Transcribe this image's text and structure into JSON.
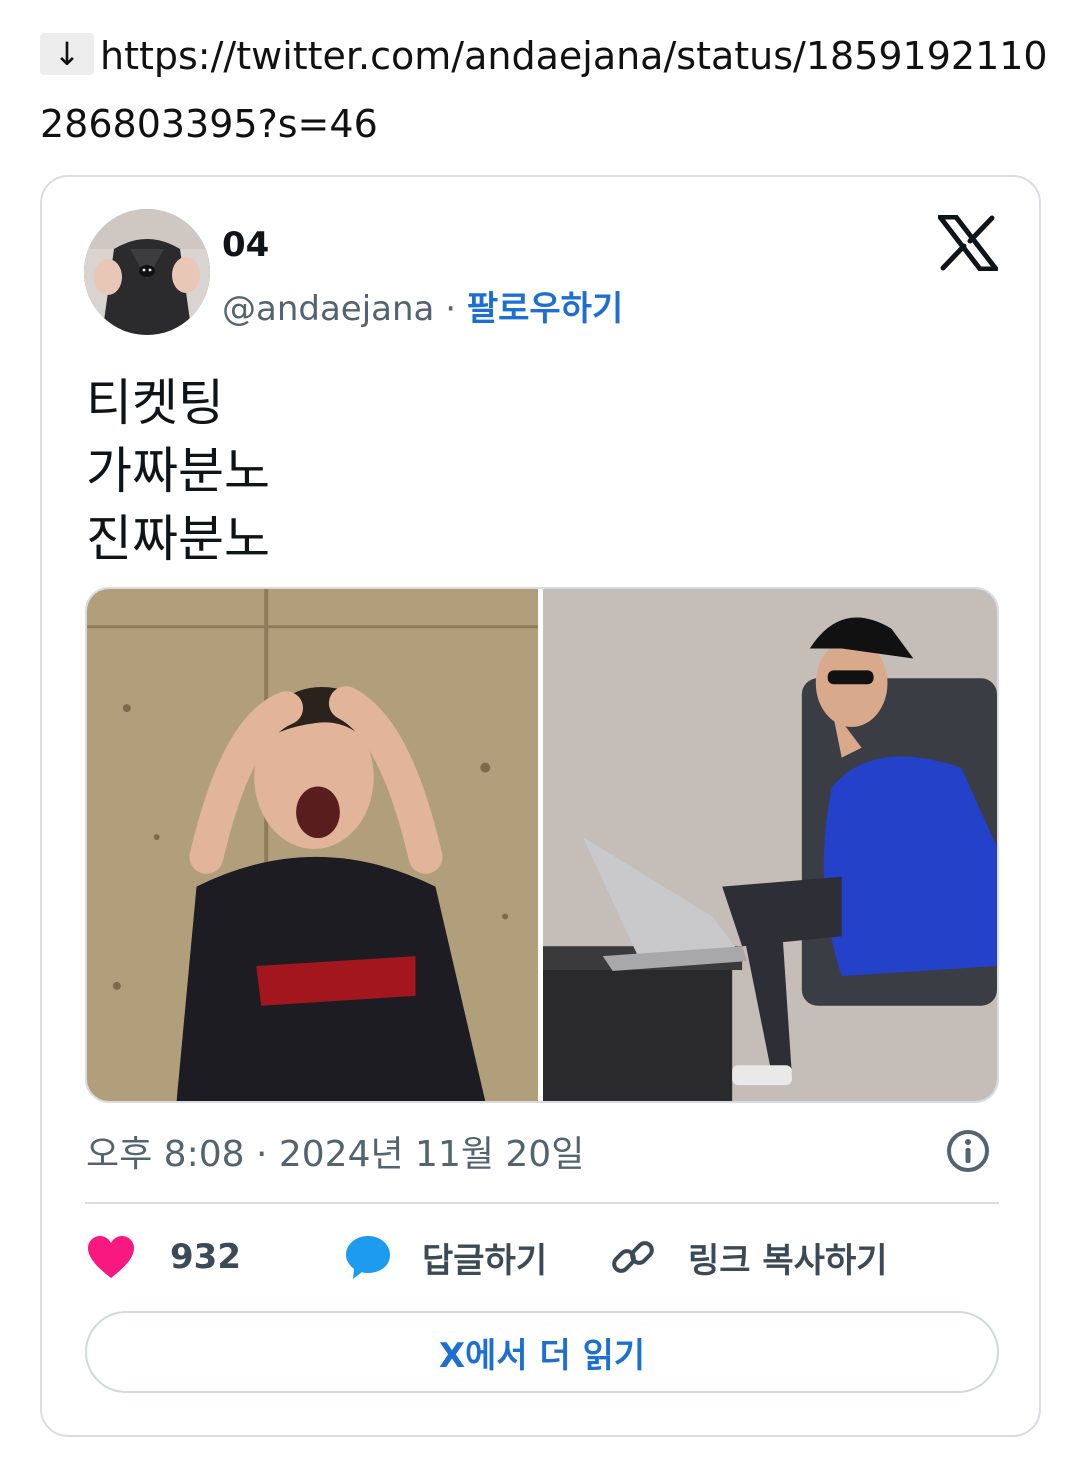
{
  "link": {
    "arrow": "↓",
    "url": "https://twitter.com/andaejana/status/1859192110286803395?s=46"
  },
  "tweet": {
    "display_name": "04",
    "handle": "@andaejana",
    "separator": " · ",
    "follow_label": "팔로우하기",
    "text_lines": [
      "티켓팅",
      "가짜분노",
      "진짜분노"
    ],
    "timestamp": "오후 8:08 · 2024년 11월 20일",
    "likes": "932",
    "reply_label": "답글하기",
    "copy_link_label": "링크 복사하기",
    "read_more_label": "X에서 더 읽기"
  },
  "icons": {
    "brand": "x-logo",
    "like": "heart-icon",
    "reply": "speech-bubble-icon",
    "copy": "link-icon",
    "info": "info-icon"
  },
  "colors": {
    "link_blue": "#1d6fd1",
    "heart": "#f91880",
    "reply_bubble": "#1d9bf0",
    "muted": "#536471"
  }
}
